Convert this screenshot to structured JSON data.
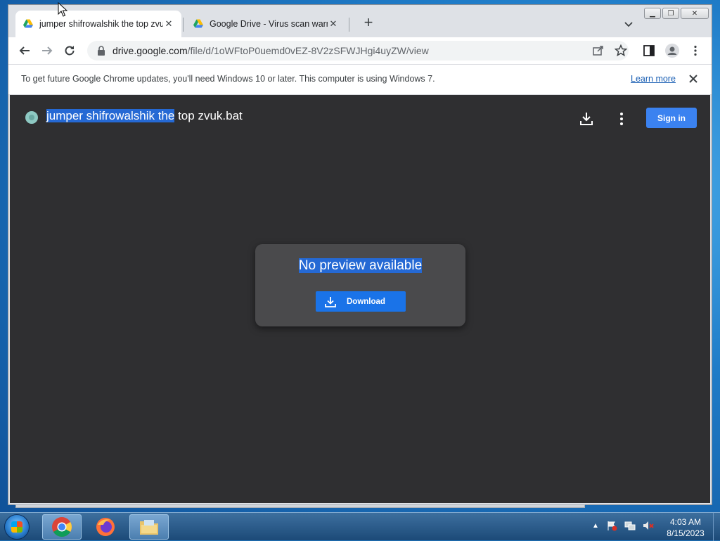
{
  "tabs": [
    {
      "title": "jumper shifrowalshik the top zvuk",
      "active": true
    },
    {
      "title": "Google Drive - Virus scan warning",
      "active": false
    }
  ],
  "toolbar": {
    "url_host": "drive.google.com",
    "url_path": "/file/d/1oWFtoP0uemd0vEZ-8V2zSFWJHgi4uyZW/view"
  },
  "infobar": {
    "message": "To get future Google Chrome updates, you'll need Windows 10 or later. This computer is using Windows 7.",
    "learn_more": "Learn more"
  },
  "drive": {
    "file_name_selected": "jumper shifrowalshik the",
    "file_name_rest": " top zvuk.bat",
    "sign_in": "Sign in",
    "no_preview": "No preview available",
    "download_label": "Download"
  },
  "taskbar": {
    "time": "4:03 AM",
    "date": "8/15/2023"
  },
  "colors": {
    "drive_bg": "#2f2f31",
    "card_bg": "#4a4a4c",
    "accent_blue": "#1a73e8",
    "selection": "#2569d4"
  }
}
